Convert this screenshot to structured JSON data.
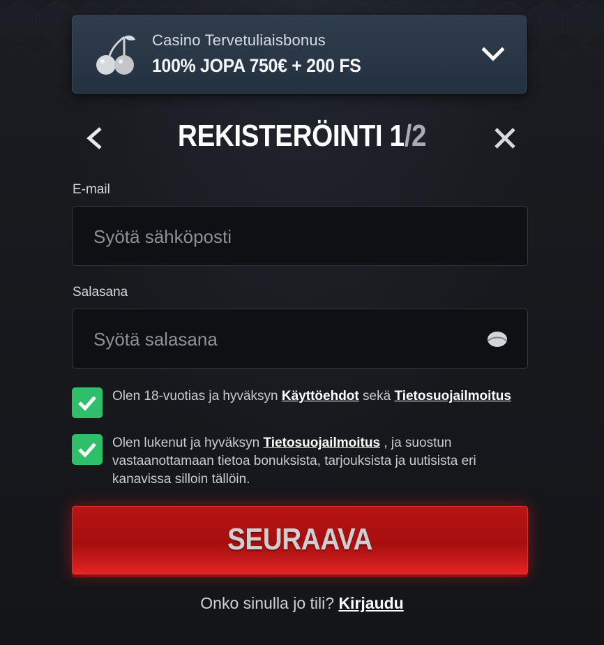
{
  "bonus": {
    "subtitle": "Casino Tervetuliaisbonus",
    "offer": "100% JOPA 750€ + 200 FS",
    "icon": "cherry-icon",
    "toggle_icon": "chevron-down-icon"
  },
  "header": {
    "title_main": "REKISTERÖINTI 1",
    "title_total": "/2",
    "back_icon": "chevron-left-icon",
    "close_icon": "close-icon"
  },
  "form": {
    "email": {
      "label": "E-mail",
      "placeholder": "Syötä sähköposti",
      "value": ""
    },
    "password": {
      "label": "Salasana",
      "placeholder": "Syötä salasana",
      "value": "",
      "toggle_icon": "eye-icon"
    }
  },
  "consents": [
    {
      "checked": true,
      "text_before": "Olen 18-vuotias ja hyväksyn ",
      "link1": "Käyttöehdot",
      "text_middle": " sekä ",
      "link2": "Tietosuojailmoitus"
    },
    {
      "checked": true,
      "text_before": "Olen lukenut ja hyväksyn ",
      "link1": "Tietosuojailmoitus",
      "text_after_line1": " , ja suostun",
      "line2": "vastaanottamaan tietoa bonuksista, tarjouksista ja uutisista eri",
      "line3": "kanavissa silloin tällöin."
    }
  ],
  "actions": {
    "next_label": "SEURAAVA",
    "login_prompt": "Onko sinulla jo tili? ",
    "login_link": "Kirjaudu"
  },
  "colors": {
    "accent_red": "#b71414",
    "checkbox_green": "#2fbf6a",
    "background": "#17191d",
    "bonus_panel": "#2a3747"
  }
}
